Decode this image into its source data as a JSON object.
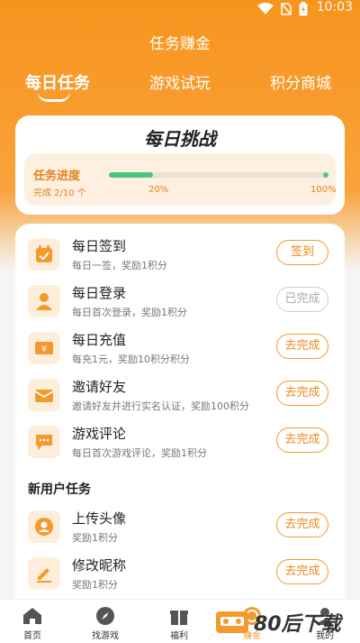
{
  "status_bar": {
    "time": "10:03"
  },
  "header": {
    "title": "任务赚金"
  },
  "tabs": [
    {
      "label": "每日任务",
      "active": true
    },
    {
      "label": "游戏试玩",
      "active": false
    },
    {
      "label": "积分商城",
      "active": false
    }
  ],
  "challenge": {
    "title": "每日挑战",
    "progress_label": "任务进度",
    "completed_text": "完成 2/10 个",
    "progress_fraction": 0.2,
    "mid_percent": "20%",
    "end_percent": "100%"
  },
  "daily_tasks": [
    {
      "title": "每日签到",
      "desc": "每日一签，奖励1积分",
      "button": "签到",
      "done": false,
      "icon": "calendar-check-icon"
    },
    {
      "title": "每日登录",
      "desc": "每日首次登录，奖励1积分",
      "button": "已完成",
      "done": true,
      "icon": "user-icon"
    },
    {
      "title": "每日充值",
      "desc": "每充1元，奖励10积分积分",
      "button": "去完成",
      "done": false,
      "icon": "money-icon"
    },
    {
      "title": "邀请好友",
      "desc": "邀请好友并进行实名认证，奖励100积分",
      "button": "去完成",
      "done": false,
      "icon": "envelope-icon"
    },
    {
      "title": "游戏评论",
      "desc": "每日首次游戏评论，奖励1积分",
      "button": "去完成",
      "done": false,
      "icon": "comment-icon"
    }
  ],
  "new_user_section": {
    "title": "新用户任务"
  },
  "new_user_tasks": [
    {
      "title": "上传头像",
      "desc": "奖励1积分",
      "button": "去完成",
      "done": false,
      "icon": "avatar-icon"
    },
    {
      "title": "修改昵称",
      "desc": "奖励1积分",
      "button": "去完成",
      "done": false,
      "icon": "edit-icon"
    }
  ],
  "bottom_nav": [
    {
      "label": "首页",
      "icon": "home-icon",
      "active": false
    },
    {
      "label": "找游戏",
      "icon": "compass-icon",
      "active": false
    },
    {
      "label": "福利",
      "icon": "gift-icon",
      "active": false
    },
    {
      "label": "赚金",
      "icon": "coin-icon",
      "active": true
    },
    {
      "label": "我的",
      "icon": "profile-icon",
      "active": false
    }
  ],
  "watermark": {
    "text": "80后下载"
  },
  "colors": {
    "accent": "#f39a2e",
    "header_bg": "#f7941d",
    "progress": "#4cc77f"
  }
}
